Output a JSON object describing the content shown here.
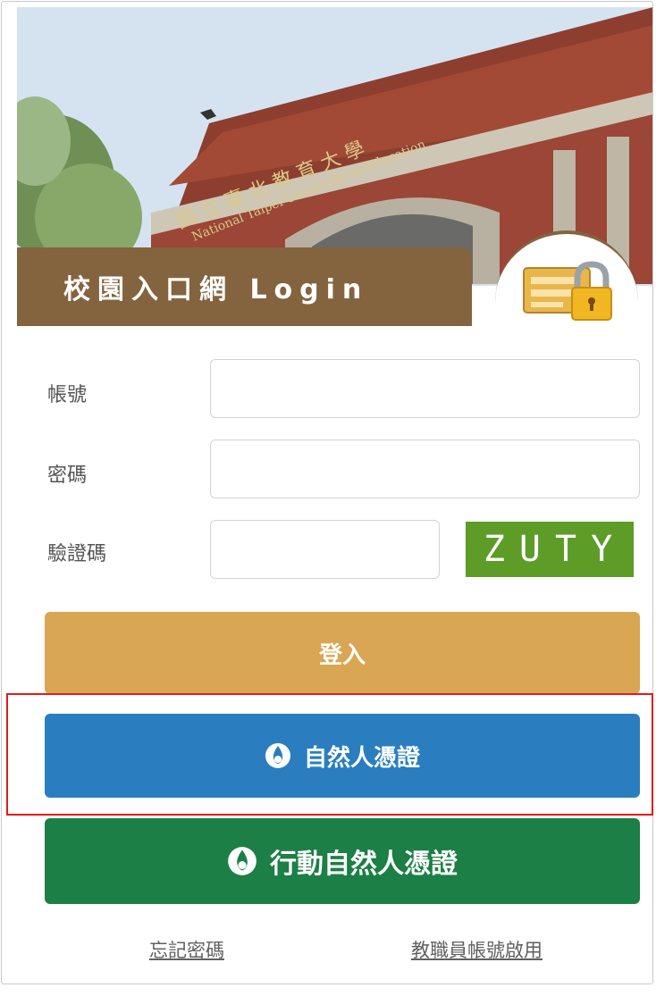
{
  "hero": {
    "signboard_text": "國立臺北教育大學 National Taipei University of Education",
    "image_description": "campus building photo"
  },
  "header": {
    "title": "校園入口網 Login",
    "badge_icon": "lock-card-icon"
  },
  "form": {
    "account_label": "帳號",
    "account_value": "",
    "password_label": "密碼",
    "password_value": "",
    "captcha_label": "驗證碼",
    "captcha_value": "",
    "captcha_code": "ZUTY"
  },
  "buttons": {
    "login_label": "登入",
    "moica_label": "自然人憑證",
    "mobile_moica_label": "行動自然人憑證",
    "moica_icon": "moica-logo-icon"
  },
  "links": {
    "forgot_password": "忘記密碼",
    "staff_activation": "教職員帳號啟用"
  },
  "colors": {
    "brand_brown": "#83643f",
    "login_button": "#d9a653",
    "moica_button": "#2a7ebf",
    "mobile_moica_button": "#1c7f45",
    "captcha_bg": "#5d9c27",
    "highlight": "#e21b1b"
  }
}
